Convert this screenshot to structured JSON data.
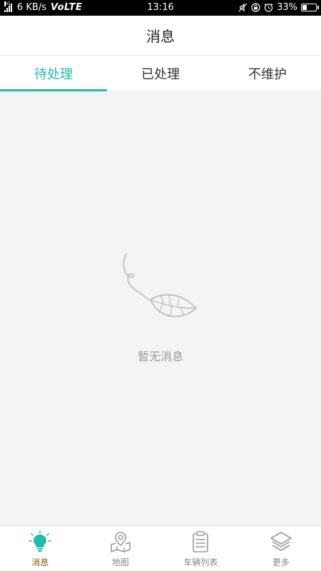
{
  "status_bar": {
    "network": "4G",
    "speed": "6 KB/s",
    "volte": "VoLTE",
    "time": "13:16",
    "battery": "33%"
  },
  "header": {
    "title": "消息"
  },
  "tabs": [
    {
      "label": "待处理",
      "active": true
    },
    {
      "label": "已处理",
      "active": false
    },
    {
      "label": "不维护",
      "active": false
    }
  ],
  "empty_state": {
    "text": "暂无消息",
    "icon": "leaf-icon"
  },
  "bottom_nav": [
    {
      "label": "消息",
      "icon": "lightbulb-icon",
      "active": true
    },
    {
      "label": "地图",
      "icon": "map-pin-icon",
      "active": false
    },
    {
      "label": "车辆列表",
      "icon": "clipboard-list-icon",
      "active": false
    },
    {
      "label": "更多",
      "icon": "layers-icon",
      "active": false
    }
  ],
  "colors": {
    "accent": "#1fbbab",
    "active_label": "#8a5a00",
    "muted": "#999999"
  }
}
